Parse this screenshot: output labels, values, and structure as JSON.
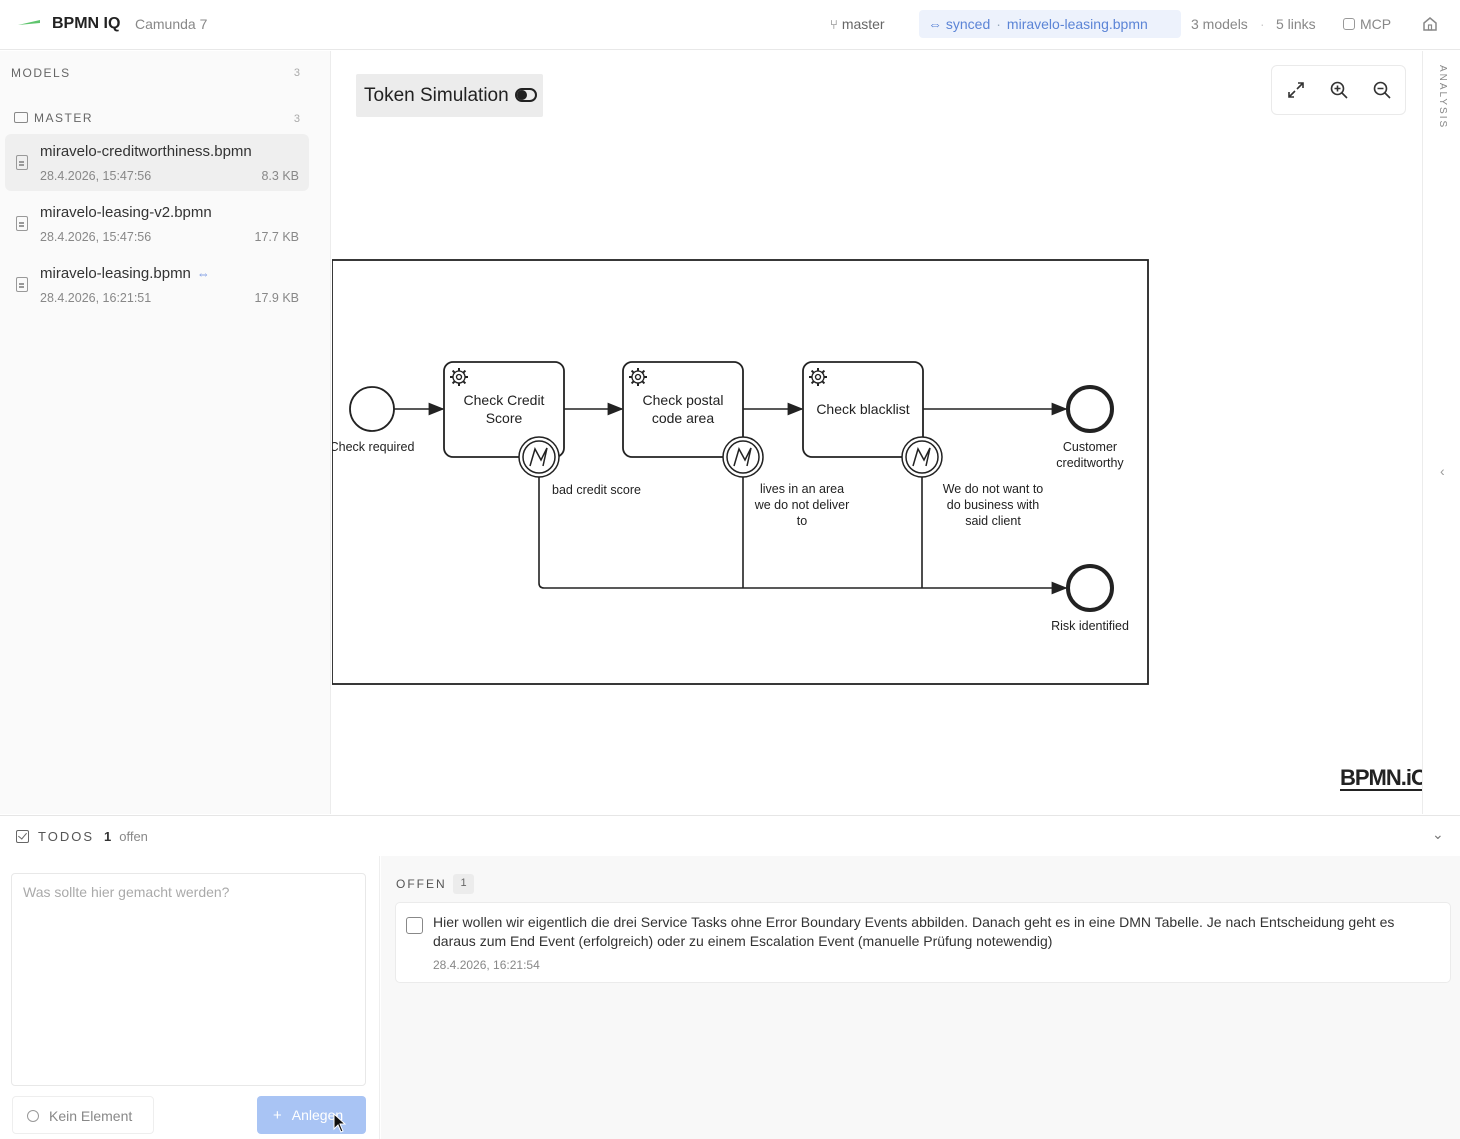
{
  "header": {
    "app_title": "BPMN IQ",
    "app_sub": "Camunda 7",
    "branch": "master",
    "sync_status": "synced",
    "sync_file": "miravelo-leasing.bpmn",
    "models_count": "3 models",
    "links_count": "5 links",
    "mcp": "MCP",
    "accent": "#5b84d6"
  },
  "sidebar": {
    "heading": "MODELS",
    "models_total": "3",
    "folder": "MASTER",
    "folder_count": "3",
    "files": [
      {
        "name": "miravelo-creditworthiness.bpmn",
        "date": "28.4.2026, 15:47:56",
        "size": "8.3 KB",
        "active": true
      },
      {
        "name": "miravelo-leasing-v2.bpmn",
        "date": "28.4.2026, 15:47:56",
        "size": "17.7 KB",
        "active": false
      },
      {
        "name": "miravelo-leasing.bpmn",
        "date": "28.4.2026, 16:21:51",
        "size": "17.9 KB",
        "active": false,
        "linked": true
      }
    ]
  },
  "canvas": {
    "token_simulation": "Token Simulation",
    "watermark": "BPMN.iO",
    "diagram": {
      "start_event": "Check required",
      "tasks": [
        "Check Credit Score",
        "Check postal code area",
        "Check blacklist"
      ],
      "boundary_labels": [
        "bad credit score",
        "lives in an area we do not deliver to",
        "We do not want to do business with said client"
      ],
      "end_events": [
        "Customer creditworthy",
        "Risk identified"
      ]
    }
  },
  "rail": {
    "label": "ANALYSIS"
  },
  "todos": {
    "title": "TODOS",
    "count": "1",
    "status": "offen",
    "placeholder": "Was sollte hier gemacht werden?",
    "no_element": "Kein Element",
    "add_label": "Anlegen",
    "open_label": "OFFEN",
    "open_count": "1",
    "items": [
      {
        "text": "Hier wollen wir eigentlich die drei Service Tasks ohne Error Boundary Events abbilden. Danach geht es in eine DMN Tabelle. Je nach Entscheidung geht es daraus zum End Event (erfolgreich) oder zu einem Escalation Event (manuelle Prüfung notewendig)",
        "date": "28.4.2026, 16:21:54"
      }
    ]
  }
}
